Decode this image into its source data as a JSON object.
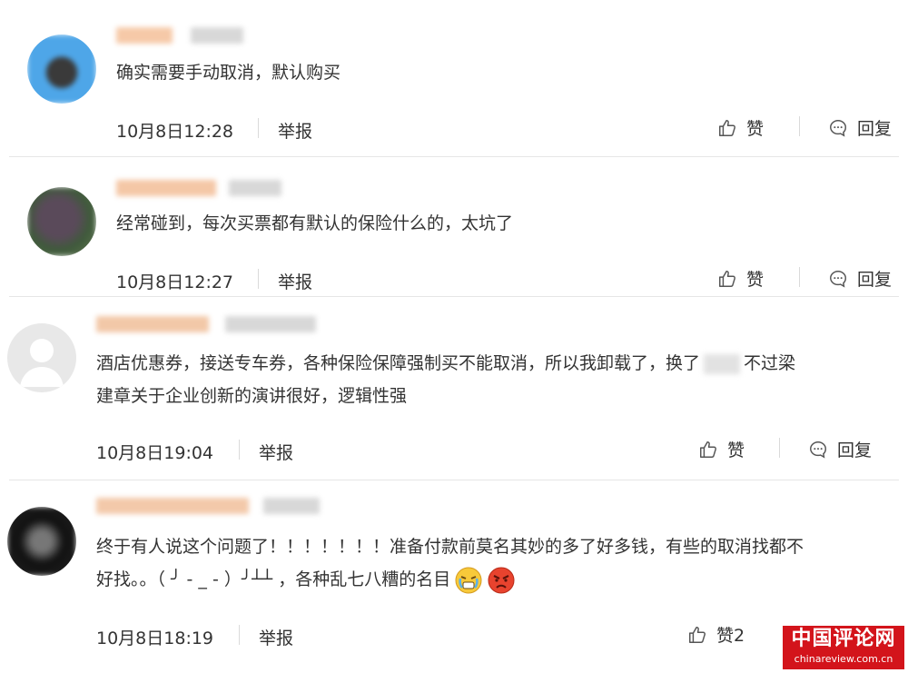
{
  "comments": [
    {
      "text": "确实需要手动取消，默认购买",
      "time": "10月8日12:28",
      "report": "举报",
      "like": "赞",
      "reply": "回复"
    },
    {
      "text": "经常碰到，每次买票都有默认的保险什么的，太坑了",
      "time": "10月8日12:27",
      "report": "举报",
      "like": "赞",
      "reply": "回复"
    },
    {
      "line1_a": "酒店优惠券，接送专车券，各种保险保障强制买不能取消，所以我卸载了，换了",
      "line1_b": "不过梁",
      "line2": "建章关于企业创新的演讲很好，逻辑性强",
      "time": "10月8日19:04",
      "report": "举报",
      "like": "赞",
      "reply": "回复"
    },
    {
      "line1": "终于有人说这个问题了！！！！！！！准备付款前莫名其妙的多了好多钱，有些的取消找都不",
      "line2": "好找。。（ ╯ - _ - ）╯┴┴ ，各种乱七八糟的名目",
      "time": "10月8日18:19",
      "report": "举报",
      "like": "赞2"
    }
  ],
  "watermark": {
    "main": "中国评论网",
    "sub": "chinareview.com.cn"
  },
  "colors": {
    "watermark_bg": "#d3141b",
    "divider": "#e6e6e6"
  }
}
